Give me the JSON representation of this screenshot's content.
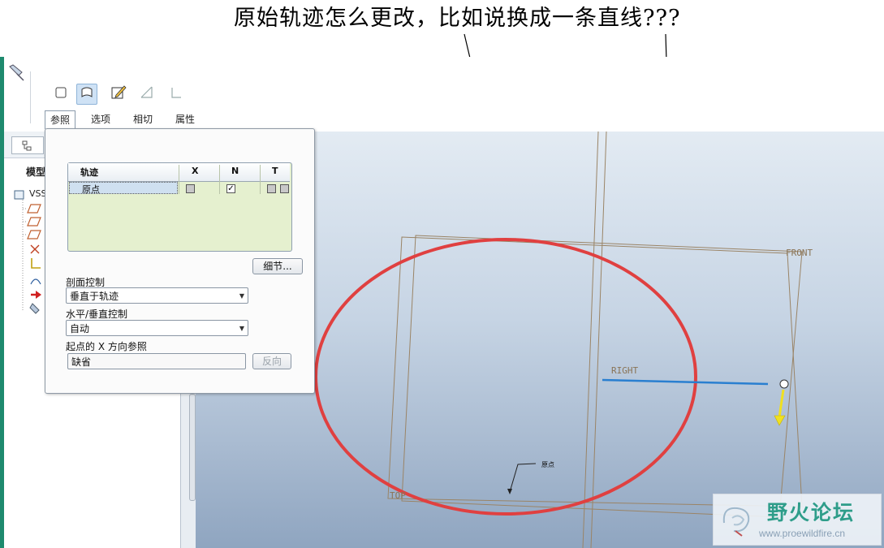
{
  "annotation": {
    "question": "原始轨迹怎么更改，比如说换成一条直线???"
  },
  "toolbar": {
    "tabs": [
      {
        "label": "参照",
        "active": true
      },
      {
        "label": "选项",
        "active": false
      },
      {
        "label": "相切",
        "active": false
      },
      {
        "label": "属性",
        "active": false
      }
    ]
  },
  "left_panel": {
    "header_label": "模型",
    "tree": [
      {
        "label": "VSS"
      }
    ]
  },
  "dialog": {
    "trajectory_table": {
      "headers": [
        "轨迹",
        "X",
        "N",
        "T"
      ],
      "rows": [
        {
          "name": "原点",
          "x": false,
          "n": true,
          "t": false
        }
      ]
    },
    "details_button": "细节...",
    "section_control": {
      "label": "剖面控制",
      "value": "垂直于轨迹"
    },
    "hv_control": {
      "label": "水平/垂直控制",
      "value": "自动"
    },
    "x_direction": {
      "label": "起点的 X 方向参照",
      "value": "缺省",
      "flip_button": "反向"
    }
  },
  "viewport": {
    "datum_labels": {
      "front": "FRONT",
      "right": "RIGHT",
      "top": "TOP"
    },
    "origin_label": "原点",
    "colors": {
      "trajectory": "#e04040",
      "datum": "#9a8466",
      "sketch_line": "#2a7fd0",
      "arrow": "#f0e020"
    }
  },
  "watermark": {
    "text": "野火论坛",
    "url": "www.proewildfire.cn"
  }
}
